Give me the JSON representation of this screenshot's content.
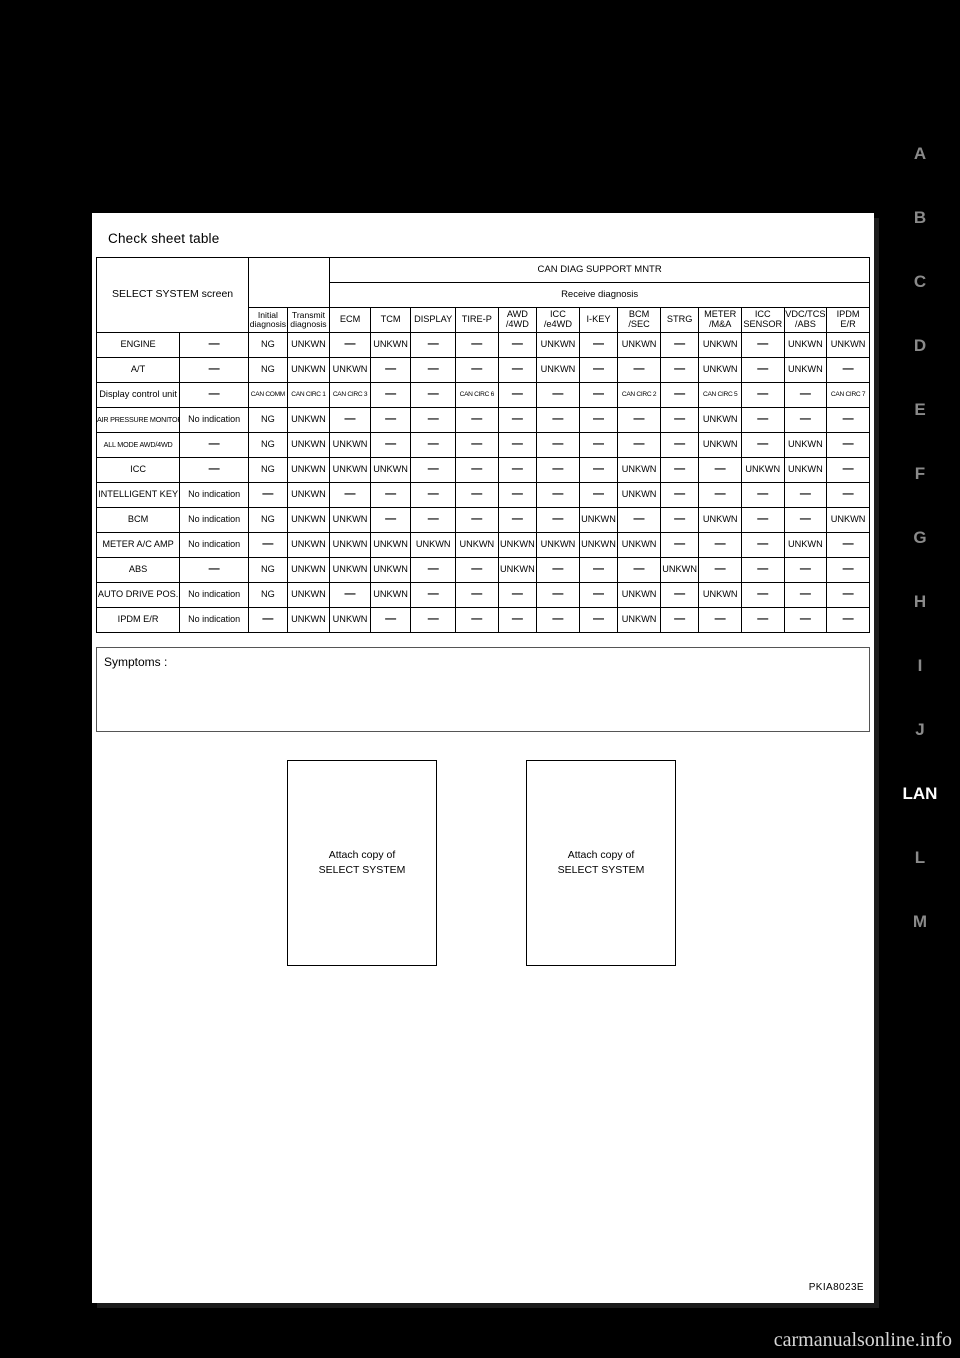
{
  "page": {
    "figure_code": "PKIA8023E",
    "watermark": "carmanualsonline.info"
  },
  "check_sheet": {
    "title": "Check sheet table",
    "header": {
      "select_system": "SELECT SYSTEM screen",
      "initial_diagnosis": "Initial\ndiagnosis",
      "initial_diagnosis_l1": "Initial",
      "initial_diagnosis_l2": "diagnosis",
      "transmit_diagnosis_l1": "Transmit",
      "transmit_diagnosis_l2": "diagnosis",
      "can_diag_support_mntr": "CAN DIAG SUPPORT MNTR",
      "receive_diagnosis": "Receive diagnosis",
      "receive_columns": [
        {
          "l1": "ECM",
          "l2": ""
        },
        {
          "l1": "TCM",
          "l2": ""
        },
        {
          "l1": "DISPLAY",
          "l2": ""
        },
        {
          "l1": "TIRE-P",
          "l2": ""
        },
        {
          "l1": "AWD",
          "l2": "/4WD"
        },
        {
          "l1": "ICC",
          "l2": "/e4WD"
        },
        {
          "l1": "I-KEY",
          "l2": ""
        },
        {
          "l1": "BCM",
          "l2": "/SEC"
        },
        {
          "l1": "STRG",
          "l2": ""
        },
        {
          "l1": "METER",
          "l2": "/M&A"
        },
        {
          "l1": "ICC",
          "l2": "SENSOR"
        },
        {
          "l1": "VDC/TCS",
          "l2": "/ABS"
        },
        {
          "l1": "IPDM",
          "l2": "E/R"
        }
      ]
    },
    "rows": [
      {
        "name": "ENGINE",
        "tiny": false,
        "status": "—",
        "initial": "NG",
        "transmit": "UNKWN",
        "receive": [
          "—",
          "UNKWN",
          "—",
          "—",
          "—",
          "UNKWN",
          "—",
          "UNKWN",
          "—",
          "UNKWN",
          "—",
          "UNKWN",
          "UNKWN"
        ]
      },
      {
        "name": "A/T",
        "tiny": false,
        "status": "—",
        "initial": "NG",
        "transmit": "UNKWN",
        "receive": [
          "UNKWN",
          "—",
          "—",
          "—",
          "—",
          "UNKWN",
          "—",
          "—",
          "—",
          "UNKWN",
          "—",
          "UNKWN",
          "—"
        ]
      },
      {
        "name": "Display control unit",
        "tiny": false,
        "status": "—",
        "initial": "CAN COMM",
        "transmit": "CAN CIRC 1",
        "receive": [
          "CAN CIRC 3",
          "—",
          "—",
          "CAN CIRC 6",
          "—",
          "—",
          "—",
          "CAN CIRC 2",
          "—",
          "CAN CIRC 5",
          "—",
          "—",
          "CAN CIRC 7"
        ],
        "small": true
      },
      {
        "name": "AIR PRESSURE MONITOR",
        "tiny": true,
        "status": "No indication",
        "initial": "NG",
        "transmit": "UNKWN",
        "receive": [
          "—",
          "—",
          "—",
          "—",
          "—",
          "—",
          "—",
          "—",
          "—",
          "UNKWN",
          "—",
          "—",
          "—"
        ]
      },
      {
        "name": "ALL MODE AWD/4WD",
        "tiny": true,
        "status": "—",
        "initial": "NG",
        "transmit": "UNKWN",
        "receive": [
          "UNKWN",
          "—",
          "—",
          "—",
          "—",
          "—",
          "—",
          "—",
          "—",
          "UNKWN",
          "—",
          "UNKWN",
          "—"
        ]
      },
      {
        "name": "ICC",
        "tiny": false,
        "status": "—",
        "initial": "NG",
        "transmit": "UNKWN",
        "receive": [
          "UNKWN",
          "UNKWN",
          "—",
          "—",
          "—",
          "—",
          "—",
          "UNKWN",
          "—",
          "—",
          "UNKWN",
          "UNKWN",
          "—"
        ]
      },
      {
        "name": "INTELLIGENT KEY",
        "tiny": false,
        "status": "No indication",
        "initial": "—",
        "transmit": "UNKWN",
        "receive": [
          "—",
          "—",
          "—",
          "—",
          "—",
          "—",
          "—",
          "UNKWN",
          "—",
          "—",
          "—",
          "—",
          "—"
        ]
      },
      {
        "name": "BCM",
        "tiny": false,
        "status": "No indication",
        "initial": "NG",
        "transmit": "UNKWN",
        "receive": [
          "UNKWN",
          "—",
          "—",
          "—",
          "—",
          "—",
          "UNKWN",
          "—",
          "—",
          "UNKWN",
          "—",
          "—",
          "UNKWN"
        ]
      },
      {
        "name": "METER A/C AMP",
        "tiny": false,
        "status": "No indication",
        "initial": "—",
        "transmit": "UNKWN",
        "receive": [
          "UNKWN",
          "UNKWN",
          "UNKWN",
          "UNKWN",
          "UNKWN",
          "UNKWN",
          "UNKWN",
          "UNKWN",
          "—",
          "—",
          "—",
          "UNKWN",
          "—"
        ]
      },
      {
        "name": "ABS",
        "tiny": false,
        "status": "—",
        "initial": "NG",
        "transmit": "UNKWN",
        "receive": [
          "UNKWN",
          "UNKWN",
          "—",
          "—",
          "UNKWN",
          "—",
          "—",
          "—",
          "UNKWN",
          "—",
          "—",
          "—",
          "—"
        ]
      },
      {
        "name": "AUTO DRIVE POS.",
        "tiny": false,
        "status": "No indication",
        "initial": "NG",
        "transmit": "UNKWN",
        "receive": [
          "—",
          "UNKWN",
          "—",
          "—",
          "—",
          "—",
          "—",
          "UNKWN",
          "—",
          "UNKWN",
          "—",
          "—",
          "—"
        ]
      },
      {
        "name": "IPDM E/R",
        "tiny": false,
        "status": "No indication",
        "initial": "—",
        "transmit": "UNKWN",
        "receive": [
          "UNKWN",
          "—",
          "—",
          "—",
          "—",
          "—",
          "—",
          "UNKWN",
          "—",
          "—",
          "—",
          "—",
          "—"
        ]
      }
    ]
  },
  "symptoms": {
    "label": "Symptoms :",
    "value": ""
  },
  "attach_boxes": [
    {
      "line1": "Attach copy of",
      "line2": "SELECT SYSTEM"
    },
    {
      "line1": "Attach copy of",
      "line2": "SELECT SYSTEM"
    }
  ],
  "margin_tabs": [
    {
      "label": "A",
      "active": false
    },
    {
      "label": "B",
      "active": false
    },
    {
      "label": "C",
      "active": false
    },
    {
      "label": "D",
      "active": false
    },
    {
      "label": "E",
      "active": false
    },
    {
      "label": "F",
      "active": false
    },
    {
      "label": "G",
      "active": false
    },
    {
      "label": "H",
      "active": false
    },
    {
      "label": "I",
      "active": false
    },
    {
      "label": "J",
      "active": false
    },
    {
      "label": "LAN",
      "active": true
    },
    {
      "label": "L",
      "active": false
    },
    {
      "label": "M",
      "active": false
    }
  ]
}
